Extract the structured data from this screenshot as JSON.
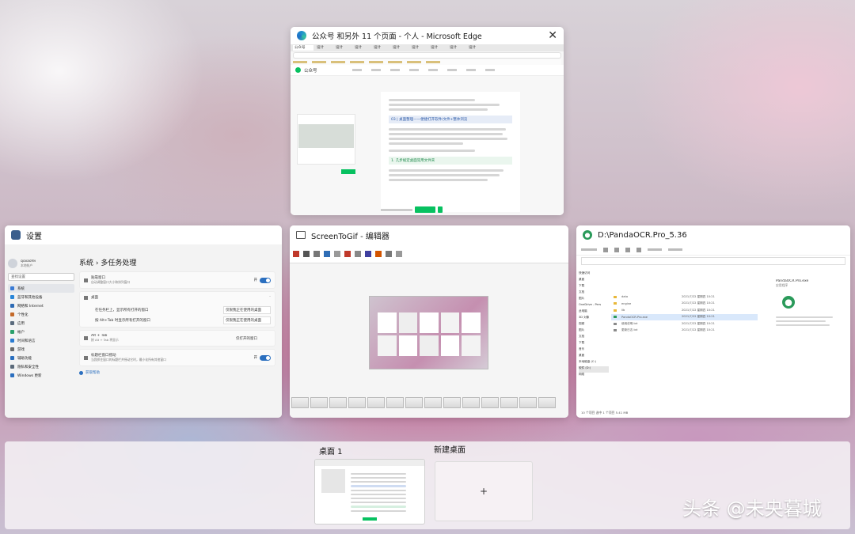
{
  "windows": {
    "edge": {
      "title": "公众号 和另外 11 个页面 - 个人 - Microsoft Edge",
      "tab_labels": [
        "公众号",
        "设计",
        "设计",
        "设计",
        "设计",
        "设计",
        "设计",
        "设计",
        "设计",
        "设计"
      ],
      "brand": "公众号",
      "editor_heading": "03 | 桌面整理——便捷打开软件/文件+整体浏览",
      "editor_subheading": "1. 几步规定桌面常用文件夹"
    },
    "settings": {
      "title": "设置",
      "user_name": "qiaiaofei",
      "user_sub": "本地帐户",
      "search_placeholder": "查找设置",
      "breadcrumb": "系统 › 多任务处理",
      "nav": [
        "系统",
        "蓝牙和其他设备",
        "网络和 Internet",
        "个性化",
        "应用",
        "帐户",
        "时间和语言",
        "游戏",
        "辅助功能",
        "隐私和安全性",
        "Windows 更新"
      ],
      "snap_title": "贴靠窗口",
      "snap_sub": "自动调整窗口大小和排列窗口",
      "snap_state": "开",
      "desktops_title": "桌面",
      "taskbar_label": "在任务栏上，显示所有打开的窗口",
      "taskbar_value": "仅限我正在使用的桌面",
      "alttab_label": "按 Alt+Tab 时显示所有打开的窗口",
      "alttab_value": "仅限我正在使用的桌面",
      "alt_title": "Alt + Tab",
      "alt_sub": "按 Alt + Tab 将显示",
      "alt_value": "仅打开的窗口",
      "shake_title": "标题栏窗口摇动",
      "shake_sub": "当我抓住窗口的标题栏并摇动它时，最小化所有其他窗口",
      "shake_state": "开",
      "help_link": "获取帮助"
    },
    "screentogif": {
      "title": "ScreenToGif - 编辑器"
    },
    "pandaocr": {
      "title": "D:\\PandaOCR.Pro_5.36",
      "preview_filename": "PandaOCR.Pro.exe",
      "preview_type": "应用程序",
      "status": "10 个项目  选中 1 个项目  5.41 MB",
      "sidebar": [
        "快速访问",
        "桌面",
        "下载",
        "文档",
        "图片",
        "OneDrive - Pers",
        "此电脑",
        "3D 对象",
        "视频",
        "图片",
        "文档",
        "下载",
        "音乐",
        "桌面",
        "本地磁盘 (C:)",
        "软件 (D:)",
        "网络"
      ],
      "files": [
        "data",
        "engine",
        "lib",
        "PandaOCR.Pro.exe",
        "使用说明.txt",
        "更新日志.txt"
      ],
      "dates": [
        "2021/7/22 星期四 10:21",
        "2021/7/22 星期四 10:21",
        "2021/7/22 星期四 10:21",
        "2021/7/22 星期四 10:21",
        "2021/7/22 星期四 10:21",
        "2021/7/22 星期四 10:21"
      ]
    }
  },
  "desktops": {
    "desktop1_label": "桌面 1",
    "new_desktop_label": "新建桌面",
    "new_desktop_plus": "+"
  },
  "watermark": "头条 @未央暮城",
  "colors": {
    "accent": "#2b6fbf",
    "wechat_green": "#07c160",
    "panel_bg": "#f2f2f4"
  }
}
